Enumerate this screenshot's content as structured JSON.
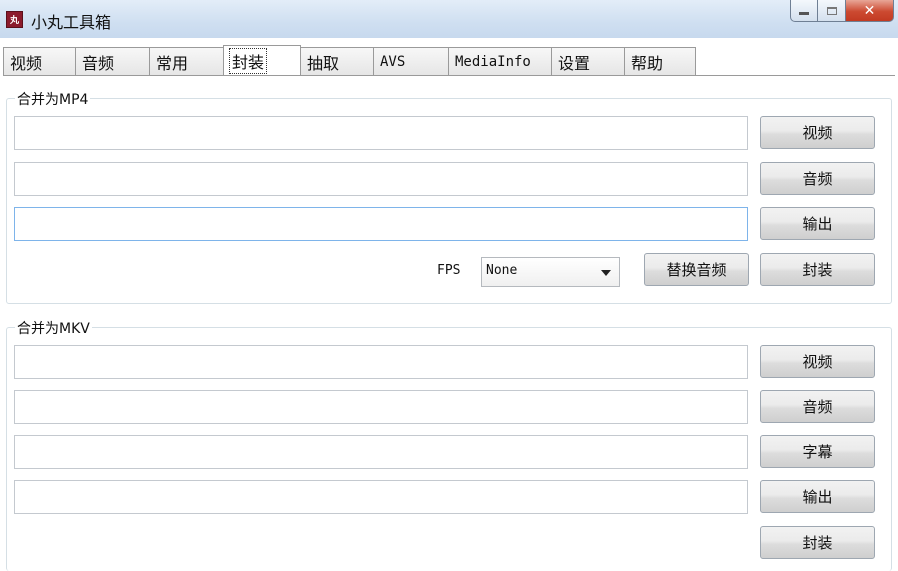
{
  "window": {
    "title": "小丸工具箱",
    "icon_text": "丸"
  },
  "tabs": [
    {
      "label": "视频"
    },
    {
      "label": "音频"
    },
    {
      "label": "常用"
    },
    {
      "label": "封装",
      "active": true
    },
    {
      "label": "抽取"
    },
    {
      "label": "AVS"
    },
    {
      "label": "MediaInfo"
    },
    {
      "label": "设置"
    },
    {
      "label": "帮助"
    }
  ],
  "mp4": {
    "title": "合并为MP4",
    "video_value": "",
    "audio_value": "",
    "output_value": "",
    "video_btn": "视频",
    "audio_btn": "音频",
    "output_btn": "输出",
    "fps_label": "FPS",
    "fps_selected": "None",
    "replace_audio_btn": "替换音频",
    "mux_btn": "封装"
  },
  "mkv": {
    "title": "合并为MKV",
    "video_value": "",
    "audio_value": "",
    "subtitle_value": "",
    "output_value": "",
    "video_btn": "视频",
    "audio_btn": "音频",
    "subtitle_btn": "字幕",
    "output_btn": "输出",
    "mux_btn": "封装"
  }
}
